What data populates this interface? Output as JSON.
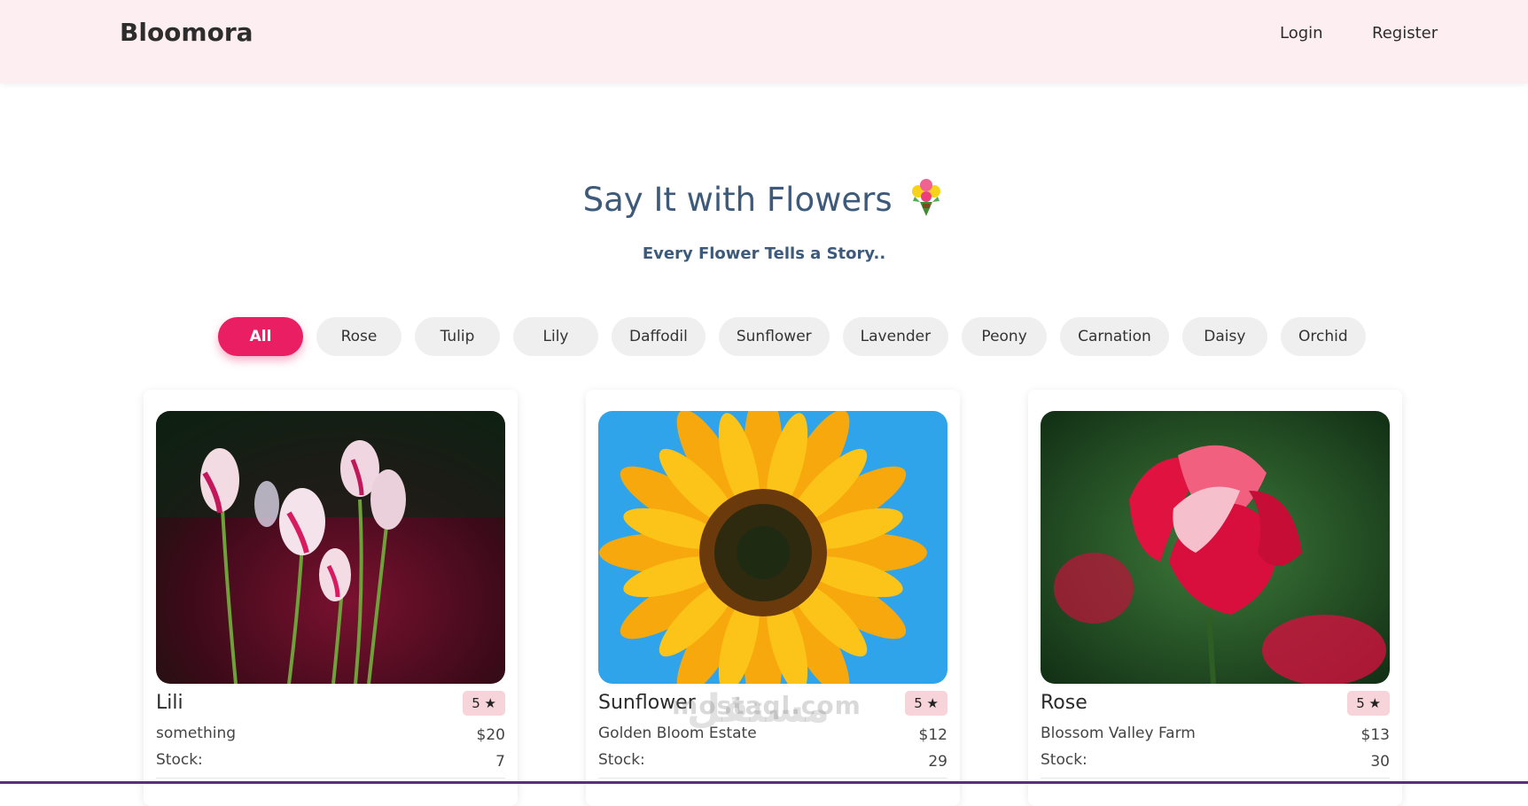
{
  "navbar": {
    "brand": "Bloomora",
    "login": "Login",
    "register": "Register"
  },
  "hero": {
    "title": "Say It with Flowers",
    "subtitle": "Every Flower Tells a Story.."
  },
  "filters": [
    "All",
    "Rose",
    "Tulip",
    "Lily",
    "Daffodil",
    "Sunflower",
    "Lavender",
    "Peony",
    "Carnation",
    "Daisy",
    "Orchid"
  ],
  "active_filter": "All",
  "products": [
    {
      "name": "Lili",
      "rating": "5 ★",
      "subtitle": "something",
      "price": "$20",
      "stock_label": "Stock:",
      "stock": "7",
      "image": "tulips-photo"
    },
    {
      "name": "Sunflower",
      "rating": "5 ★",
      "subtitle": "Golden Bloom Estate",
      "price": "$12",
      "stock_label": "Stock:",
      "stock": "29",
      "image": "sunflower-photo"
    },
    {
      "name": "Rose",
      "rating": "5 ★",
      "subtitle": "Blossom Valley Farm",
      "price": "$13",
      "stock_label": "Stock:",
      "stock": "30",
      "image": "rose-photo"
    }
  ],
  "watermark": {
    "text": "mostaql.com",
    "arabic": "مستقل"
  },
  "colors": {
    "navbar_bg": "#fdeef2",
    "accent": "#e91e63",
    "title": "#3d5a7a",
    "rating_bg": "#f6d4d9"
  }
}
